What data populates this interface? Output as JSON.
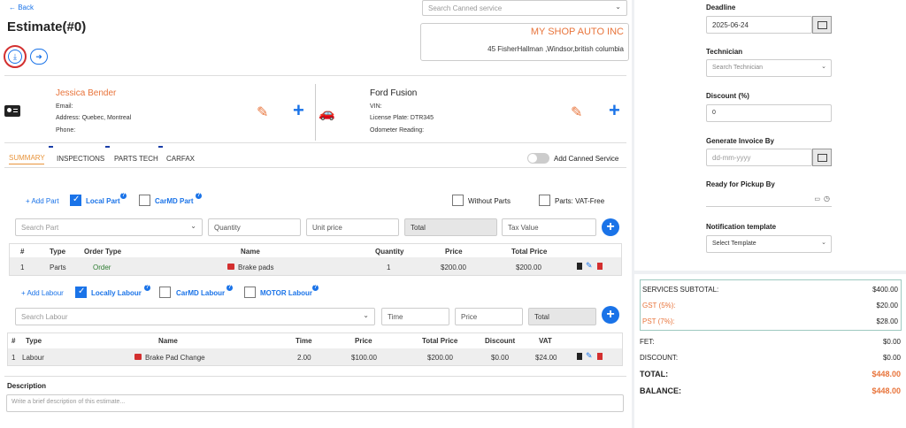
{
  "header": {
    "back_label": "← Back",
    "title": "Estimate(#0)",
    "canned_search_placeholder": "Search Canned service"
  },
  "shop": {
    "name": "MY SHOP AUTO INC",
    "address": "45 FisherHallman ,Windsor,british columbia"
  },
  "customer": {
    "name": "Jessica Bender",
    "email_label": "Email:",
    "address_label": "Address: Quebec, Montreal",
    "phone_label": "Phone:"
  },
  "vehicle": {
    "name": "Ford Fusion",
    "vin_label": "VIN:",
    "plate_label": "License Plate: DTR345",
    "odometer_label": "Odometer Reading:"
  },
  "tabs": [
    {
      "label": "SUMMARY",
      "active": true
    },
    {
      "label": "INSPECTIONS"
    },
    {
      "label": "PARTS TECH"
    },
    {
      "label": "CARFAX"
    }
  ],
  "add_canned_label": "Add Canned Service",
  "parts": {
    "add_label": "+ Add Part",
    "local_label": "Local Part",
    "carmd_label": "CarMD Part",
    "without_parts_label": "Without Parts",
    "vat_free_label": "Parts: VAT-Free",
    "search_placeholder": "Search Part",
    "quantity_placeholder": "Quantity",
    "unit_price_placeholder": "Unit price",
    "total_label": "Total",
    "tax_placeholder": "Tax Value",
    "headers": [
      "#",
      "Type",
      "Order Type",
      "Name",
      "Quantity",
      "Price",
      "Total Price"
    ],
    "rows": [
      {
        "num": "1",
        "type": "Parts",
        "order_type": "Order",
        "name": "Brake pads",
        "quantity": "1",
        "price": "$200.00",
        "total": "$200.00"
      }
    ]
  },
  "labour": {
    "add_label": "+ Add Labour",
    "local_label": "Locally Labour",
    "carmd_label": "CarMD Labour",
    "motor_label": "MOTOR Labour",
    "search_placeholder": "Search Labour",
    "time_placeholder": "Time",
    "price_placeholder": "Price",
    "total_label": "Total",
    "headers": [
      "#",
      "Type",
      "Name",
      "Time",
      "Price",
      "Total Price",
      "Discount",
      "VAT"
    ],
    "rows": [
      {
        "num": "1",
        "type": "Labour",
        "name": "Brake Pad Change",
        "time": "2.00",
        "price": "$100.00",
        "total": "$200.00",
        "discount": "$0.00",
        "vat": "$24.00"
      }
    ]
  },
  "description": {
    "label": "Description",
    "placeholder": "Write a brief description of this estimate..."
  },
  "sidebar": {
    "deadline_label": "Deadline",
    "deadline_value": "2025-06-24",
    "technician_label": "Technician",
    "technician_placeholder": "Search Technician",
    "discount_label": "Discount (%)",
    "discount_value": "0",
    "invoice_label": "Generate Invoice By",
    "invoice_placeholder": "dd-mm-yyyy",
    "pickup_label": "Ready for Pickup By",
    "notification_label": "Notification template",
    "notification_placeholder": "Select Template"
  },
  "summary": {
    "services_subtotal_label": "SERVICES SUBTOTAL:",
    "services_subtotal_value": "$400.00",
    "gst_label": "GST (5%):",
    "gst_value": "$20.00",
    "pst_label": "PST (7%):",
    "pst_value": "$28.00",
    "fet_label": "FET:",
    "fet_value": "$0.00",
    "discount_label": "DISCOUNT:",
    "discount_value": "$0.00",
    "total_label": "TOTAL:",
    "total_value": "$448.00",
    "balance_label": "BALANCE:",
    "balance_value": "$448.00"
  },
  "colors": {
    "accent": "#1a73e8",
    "orange": "#e8743b",
    "highlight": "#d32f2f"
  }
}
